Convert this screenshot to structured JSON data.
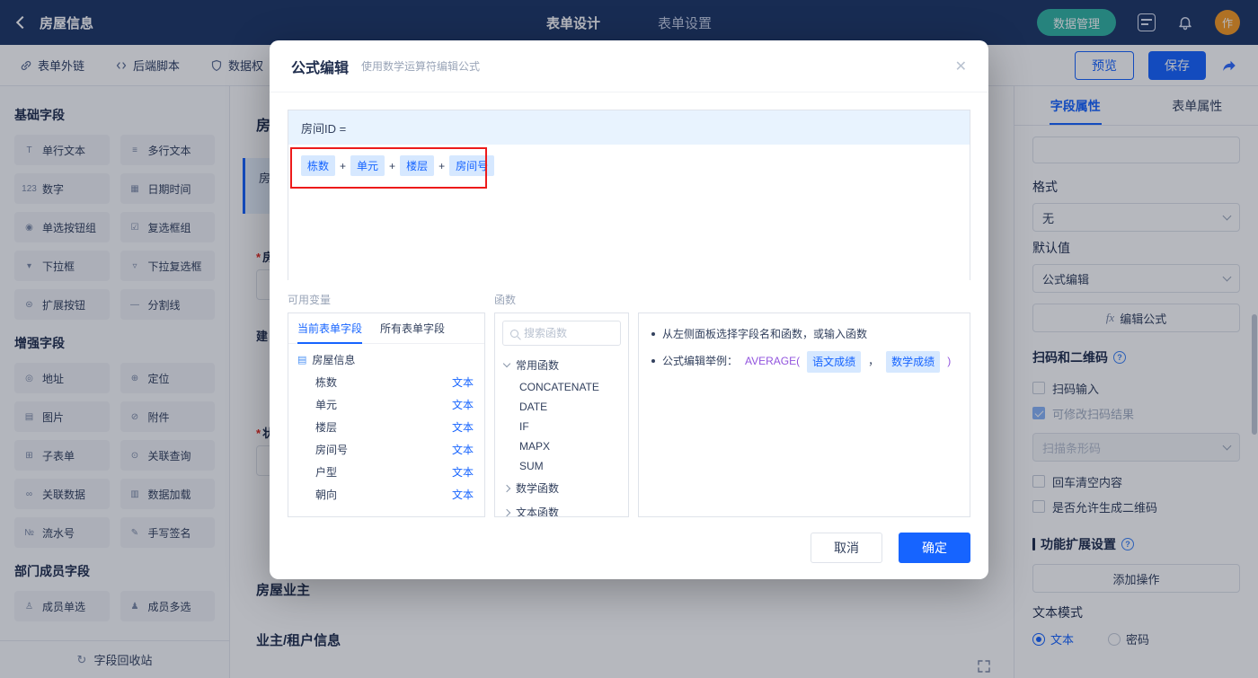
{
  "colors": {
    "accent_blue": "#1664ff",
    "topbar_navy": "#1e3766",
    "teal": "#31b3a2",
    "avatar_orange": "#f59a23",
    "highlight_red": "#ed1b1b",
    "chip_bg": "#d6e8ff",
    "function_purple": "#9254de"
  },
  "topbar": {
    "back_label": "房屋信息",
    "tab_design": "表单设计",
    "tab_settings": "表单设置",
    "data_manage": "数据管理",
    "avatar": "作"
  },
  "toolbar": {
    "external_link": "表单外链",
    "backend_script": "后端脚本",
    "data_permission": "数据权",
    "preview": "预览",
    "save": "保存"
  },
  "sidebar": {
    "section_basic": "基础字段",
    "section_enhanced": "增强字段",
    "section_member": "部门成员字段",
    "recycle": "字段回收站",
    "recycle_icon": "↻",
    "basic_items": [
      {
        "label": "单行文本",
        "icon": "T"
      },
      {
        "label": "多行文本",
        "icon": "≡"
      },
      {
        "label": "数字",
        "icon": "123"
      },
      {
        "label": "日期时间",
        "icon": "▦"
      },
      {
        "label": "单选按钮组",
        "icon": "◉"
      },
      {
        "label": "复选框组",
        "icon": "☑"
      },
      {
        "label": "下拉框",
        "icon": "▾"
      },
      {
        "label": "下拉复选框",
        "icon": "▿"
      },
      {
        "label": "扩展按钮",
        "icon": "⊜"
      },
      {
        "label": "分割线",
        "icon": "—"
      }
    ],
    "enhanced_items": [
      {
        "label": "地址",
        "icon": "◎"
      },
      {
        "label": "定位",
        "icon": "⊕"
      },
      {
        "label": "图片",
        "icon": "▤"
      },
      {
        "label": "附件",
        "icon": "⊘"
      },
      {
        "label": "子表单",
        "icon": "⊞"
      },
      {
        "label": "关联查询",
        "icon": "⊙"
      },
      {
        "label": "关联数据",
        "icon": "∞"
      },
      {
        "label": "数据加载",
        "icon": "▥"
      },
      {
        "label": "流水号",
        "icon": "№"
      },
      {
        "label": "手写签名",
        "icon": "✎"
      }
    ],
    "member_items": [
      {
        "label": "成员单选",
        "icon": "♙"
      },
      {
        "label": "成员多选",
        "icon": "♟"
      }
    ]
  },
  "canvas": {
    "required_mark": "*",
    "title_partial": "房",
    "card_partial": "房",
    "label1": {
      "text": "房"
    },
    "label2": {
      "text": "建"
    },
    "label3": {
      "text": "状"
    },
    "section_owner": "房屋业主",
    "section_tenant": "业主/租户信息"
  },
  "properties": {
    "tab_field": "字段属性",
    "tab_form": "表单属性",
    "format_label": "格式",
    "format_value": "无",
    "default_label": "默认值",
    "default_value": "公式编辑",
    "fx": "fx",
    "edit_formula": "编辑公式",
    "scan_section": "扫码和二维码",
    "help_glyph": "?",
    "cb_scan_input": "扫码输入",
    "cb_editable_result": "可修改扫码结果",
    "barcode_select": "扫描条形码",
    "cb_enter_clear": "回车清空内容",
    "cb_allow_qr": "是否允许生成二维码",
    "ext_section": "功能扩展设置",
    "add_action": "添加操作",
    "text_mode_label": "文本模式",
    "radio_text": "文本",
    "radio_password": "密码"
  },
  "modal": {
    "title": "公式编辑",
    "subtitle": "使用数学运算符编辑公式",
    "close_glyph": "✕",
    "formula_target": "房间ID =",
    "operator": "+",
    "tokens": [
      "栋数",
      "单元",
      "楼层",
      "房间号"
    ],
    "vars": {
      "label": "可用变量",
      "tab_current": "当前表单字段",
      "tab_all": "所有表单字段",
      "form_name": "房屋信息",
      "file_glyph": "▤",
      "rows": [
        {
          "name": "栋数",
          "type": "文本"
        },
        {
          "name": "单元",
          "type": "文本"
        },
        {
          "name": "楼层",
          "type": "文本"
        },
        {
          "name": "房间号",
          "type": "文本"
        },
        {
          "name": "户型",
          "type": "文本"
        },
        {
          "name": "朝向",
          "type": "文本"
        }
      ]
    },
    "funcs": {
      "label": "函数",
      "search_placeholder": "搜索函数",
      "group_common": "常用函数",
      "common_items": [
        "CONCATENATE",
        "DATE",
        "IF",
        "MAPX",
        "SUM"
      ],
      "group_math": "数学函数",
      "group_text": "文本函数"
    },
    "help": {
      "line1": "从左侧面板选择字段名和函数，或输入函数",
      "intro": "公式编辑举例：",
      "func": "AVERAGE(",
      "chip1": "语文成绩",
      "separator": "，",
      "chip2": "数学成绩",
      "close": ")"
    },
    "cancel": "取消",
    "ok": "确定"
  }
}
